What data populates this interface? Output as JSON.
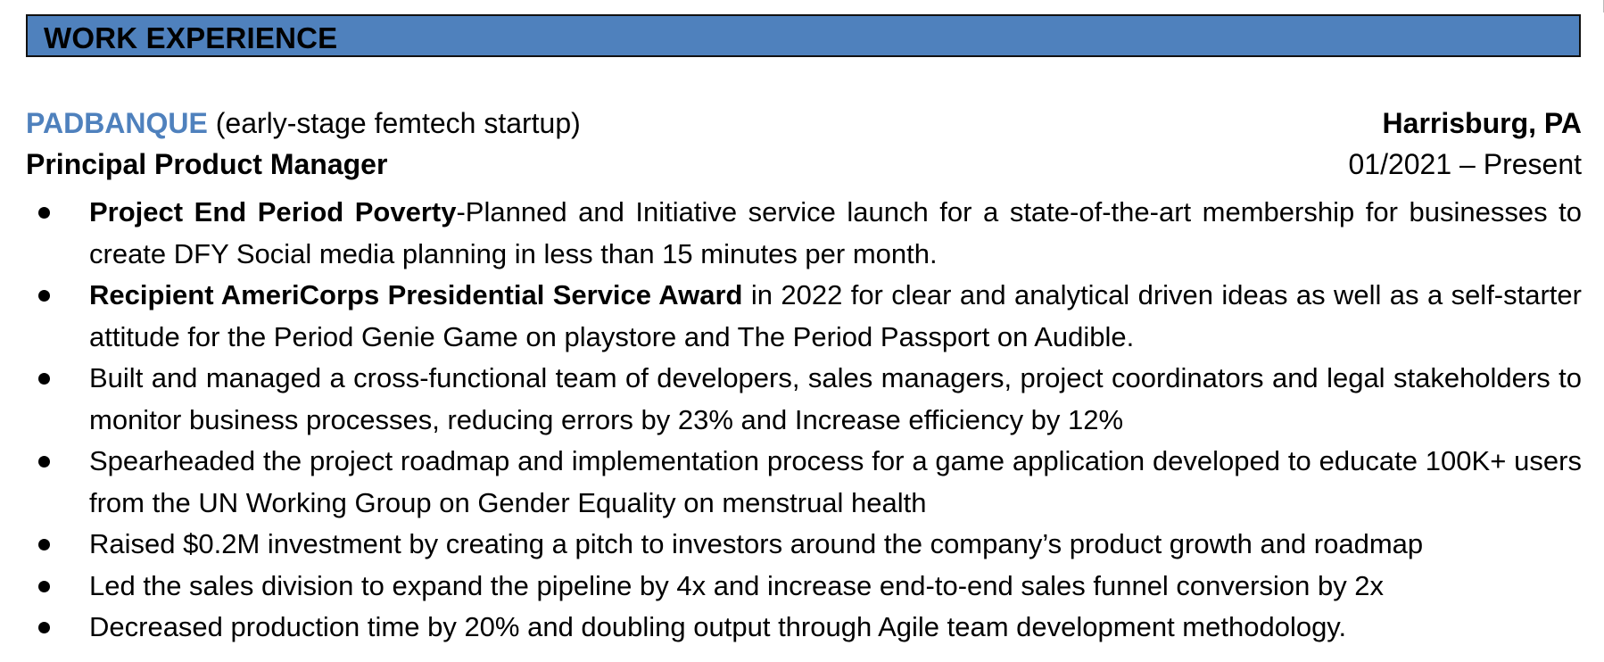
{
  "section": {
    "title": "WORK EXPERIENCE"
  },
  "job": {
    "company": "PADBANQUE",
    "company_descriptor": " (early-stage femtech startup)",
    "location": "Harrisburg, PA",
    "role": "Principal Product Manager",
    "dates": "01/2021 – Present"
  },
  "bullets": [
    {
      "strong": "Project End Period Poverty",
      "text": "-Planned and Initiative service launch for a state-of-the-art membership for businesses to create DFY Social media planning in less than 15 minutes per month."
    },
    {
      "strong": "Recipient AmeriCorps Presidential Service Award",
      "text": " in 2022 for clear and analytical driven ideas as well as a self-starter attitude for the Period Genie Game on playstore and The Period Passport on Audible."
    },
    {
      "strong": "",
      "text": "Built and managed a cross-functional team of developers, sales managers, project coordinators and legal stakeholders to monitor business processes, reducing errors by 23% and Increase efficiency by 12%"
    },
    {
      "strong": "",
      "text": "Spearheaded the project roadmap and implementation process for a game application developed to educate 100K+ users from the UN Working Group on Gender Equality on menstrual health"
    },
    {
      "strong": "",
      "text": "Raised $0.2M investment by creating a pitch to investors around the company’s product growth and roadmap"
    },
    {
      "strong": "",
      "text": "Led the sales division to expand the pipeline by 4x and increase end-to-end sales funnel conversion by 2x"
    },
    {
      "strong": "",
      "text": "Decreased production time by 20% and doubling output through Agile team development methodology."
    }
  ],
  "colors": {
    "header_band": "#4f81bd",
    "company_accent": "#4f81bd",
    "text": "#000000"
  }
}
